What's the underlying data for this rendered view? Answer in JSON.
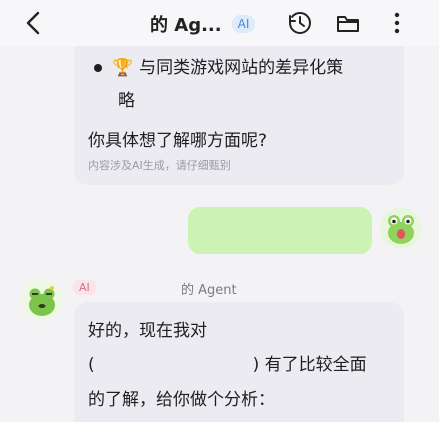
{
  "header": {
    "title": "的 Ag...",
    "ai_badge": "AI",
    "icons": [
      "back-arrow-icon",
      "history-clock-icon",
      "folder-icon",
      "more-vertical-icon"
    ]
  },
  "messages": {
    "ai_top": {
      "bullet_line1": "与同类游戏网站的差异化策",
      "bullet_line2": "略",
      "question": "你具体想了解哪方面呢?",
      "disclaimer": "内容涉及AI生成，请仔细甄别"
    },
    "agent": {
      "ai_tag": "AI",
      "name": "的 Agent"
    },
    "ai_bottom": {
      "line1": "好的，现在我对",
      "line2_open": "(",
      "line2_close": ") 有了比较全面",
      "line3": "的了解，给你做个分析："
    }
  },
  "colors": {
    "background": "#f3f3f6",
    "ai_bubble": "#ebebf1",
    "user_bubble": "#ccf3b3",
    "ai_badge_bg": "#dcecfb",
    "ai_tag_bg": "#fbe3ea"
  }
}
